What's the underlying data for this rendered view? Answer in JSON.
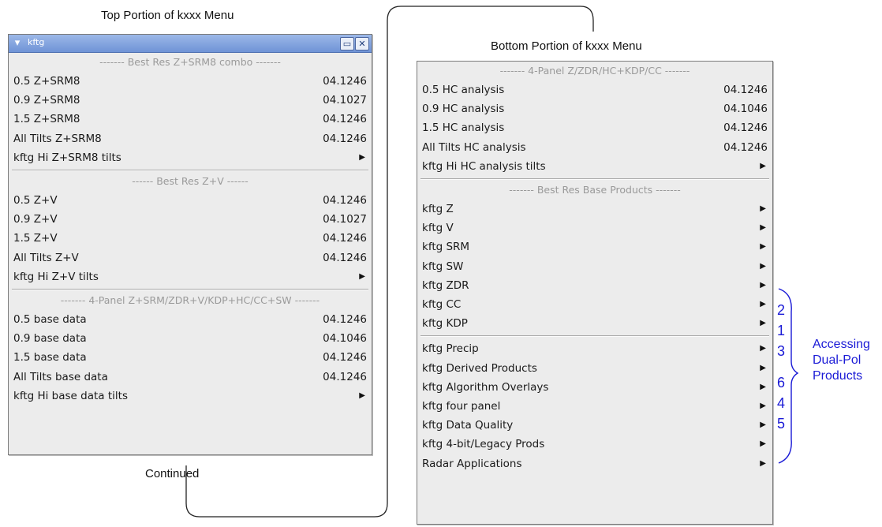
{
  "captions": {
    "top": "Top Portion of kxxx Menu",
    "bottom": "Bottom Portion of kxxx Menu",
    "continued": "Continued"
  },
  "left_menu": {
    "window_title": "kftg",
    "title_icons": [
      "chevron-down-icon",
      "maximize-icon",
      "close-icon"
    ],
    "sections": [
      {
        "header": "------- Best Res Z+SRM8 combo -------",
        "rows": [
          {
            "label": "0.5 Z+SRM8",
            "version": "04.1246"
          },
          {
            "label": "0.9 Z+SRM8",
            "version": "04.1027"
          },
          {
            "label": "1.5 Z+SRM8",
            "version": "04.1246"
          },
          {
            "label": "All Tilts Z+SRM8",
            "version": "04.1246"
          },
          {
            "label": "kftg Hi Z+SRM8 tilts",
            "submenu": true
          }
        ]
      },
      {
        "header": "------ Best Res Z+V ------",
        "rows": [
          {
            "label": "0.5 Z+V",
            "version": "04.1246"
          },
          {
            "label": "0.9 Z+V",
            "version": "04.1027"
          },
          {
            "label": "1.5 Z+V",
            "version": "04.1246"
          },
          {
            "label": "All Tilts Z+V",
            "version": "04.1246"
          },
          {
            "label": "kftg Hi Z+V tilts",
            "submenu": true
          }
        ]
      },
      {
        "header": "------- 4-Panel Z+SRM/ZDR+V/KDP+HC/CC+SW -------",
        "rows": [
          {
            "label": "0.5 base data",
            "version": "04.1246"
          },
          {
            "label": "0.9 base data",
            "version": "04.1046"
          },
          {
            "label": "1.5 base data",
            "version": "04.1246"
          },
          {
            "label": "All Tilts base data",
            "version": "04.1246"
          },
          {
            "label": "kftg Hi base data tilts",
            "submenu": true
          }
        ]
      }
    ]
  },
  "right_menu": {
    "sections": [
      {
        "header": "------- 4-Panel Z/ZDR/HC+KDP/CC -------",
        "rows": [
          {
            "label": "0.5 HC analysis",
            "version": "04.1246"
          },
          {
            "label": "0.9 HC analysis",
            "version": "04.1046"
          },
          {
            "label": "1.5 HC analysis",
            "version": "04.1246"
          },
          {
            "label": "All Tilts HC analysis",
            "version": "04.1246"
          },
          {
            "label": "kftg Hi HC analysis tilts",
            "submenu": true
          }
        ]
      },
      {
        "header": "------- Best Res Base Products -------",
        "rows": [
          {
            "label": "kftg Z",
            "submenu": true
          },
          {
            "label": "kftg V",
            "submenu": true
          },
          {
            "label": "kftg SRM",
            "submenu": true
          },
          {
            "label": "kftg SW",
            "submenu": true
          },
          {
            "label": "kftg ZDR",
            "submenu": true
          },
          {
            "label": "kftg CC",
            "submenu": true
          },
          {
            "label": "kftg KDP",
            "submenu": true
          }
        ]
      },
      {
        "header": null,
        "rows": [
          {
            "label": "kftg Precip",
            "submenu": true
          },
          {
            "label": "kftg Derived Products",
            "submenu": true
          },
          {
            "label": "kftg Algorithm Overlays",
            "submenu": true
          },
          {
            "label": "kftg four panel",
            "submenu": true
          },
          {
            "label": "kftg Data Quality",
            "submenu": true
          },
          {
            "label": "kftg 4-bit/Legacy Prods",
            "submenu": true
          },
          {
            "label": "Radar Applications",
            "submenu": true
          }
        ]
      }
    ]
  },
  "annotation": {
    "numbers": [
      "2",
      "1",
      "3",
      "6",
      "4",
      "5"
    ],
    "note_lines": [
      "Accessing",
      "Dual-Pol",
      "Products"
    ],
    "color": "#1a1ad6"
  }
}
